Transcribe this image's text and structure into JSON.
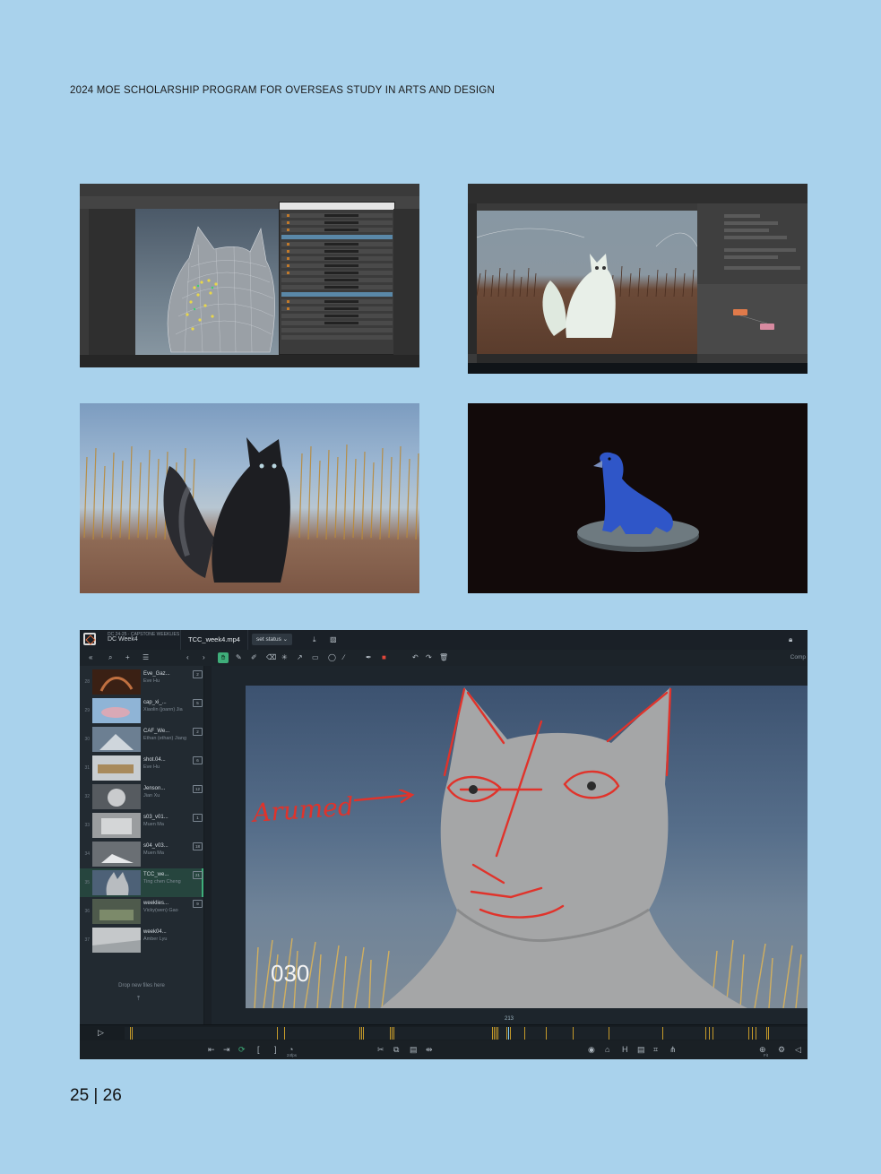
{
  "document": {
    "header": "2024 MOE SCHOLARSHIP PROGRAM FOR OVERSEAS STUDY IN ARTS AND DESIGN",
    "page_numbers": "25 | 26"
  },
  "review_app": {
    "project_line1": "DC 24-25 · CAPSTONE WEEKLIES",
    "project_line2": "DC Week4",
    "file_tab": "TCC_week4.mp4",
    "status_dropdown": "set status",
    "compare_label": "Comp",
    "files": [
      {
        "num": "28",
        "name": "Eve_Gaz...",
        "user": "Eve Hu",
        "count": "2"
      },
      {
        "num": "29",
        "name": "cap_xi_...",
        "user": "Xiaolin (joann) Jia",
        "count": "5"
      },
      {
        "num": "30",
        "name": "CAF_We...",
        "user": "Ethan (ethan) Jiang",
        "count": "2"
      },
      {
        "num": "31",
        "name": "shot.04...",
        "user": "Eve Hu",
        "count": "6"
      },
      {
        "num": "32",
        "name": "Jenson...",
        "user": "Jian Xu",
        "count": "12"
      },
      {
        "num": "33",
        "name": "s03_v01...",
        "user": "Muen Ma",
        "count": "1"
      },
      {
        "num": "34",
        "name": "s04_v03...",
        "user": "Muen Ma",
        "count": "18"
      },
      {
        "num": "35",
        "name": "TCC_we...",
        "user": "Ting chen Cheng",
        "count": "21"
      },
      {
        "num": "36",
        "name": "weeklies...",
        "user": "Vicky(wen) Gao",
        "count": "9"
      },
      {
        "num": "37",
        "name": "week04...",
        "user": "Amber Lyu",
        "count": ""
      }
    ],
    "drop_text": "Drop new files here",
    "annotation_text": "Arumed",
    "frame_label": "030",
    "current_frame": "213",
    "fps_label": "24fps",
    "zoom_label": "Fit"
  },
  "colors": {
    "page_bg": "#a9d2ec",
    "accent_green": "#3fae7a",
    "annotation_red": "#e0332b"
  }
}
